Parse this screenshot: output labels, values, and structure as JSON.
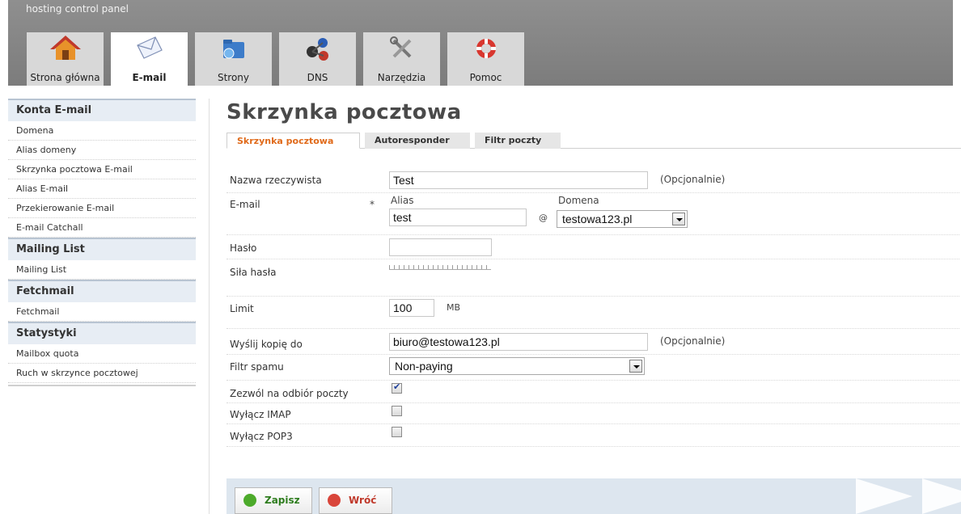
{
  "header": {
    "title": "hosting control panel",
    "tabs": [
      {
        "label": "Strona główna",
        "icon": "home-icon"
      },
      {
        "label": "E-mail",
        "icon": "envelope-icon",
        "active": true
      },
      {
        "label": "Strony",
        "icon": "folder-globe-icon"
      },
      {
        "label": "DNS",
        "icon": "network-icon"
      },
      {
        "label": "Narzędzia",
        "icon": "tools-icon"
      },
      {
        "label": "Pomoc",
        "icon": "lifebuoy-icon"
      }
    ]
  },
  "sidebar": {
    "sections": [
      {
        "title": "Konta E-mail",
        "items": [
          "Domena",
          "Alias domeny",
          "Skrzynka pocztowa E-mail",
          "Alias E-mail",
          "Przekierowanie E-mail",
          "E-mail Catchall"
        ]
      },
      {
        "title": "Mailing List",
        "items": [
          "Mailing List"
        ]
      },
      {
        "title": "Fetchmail",
        "items": [
          "Fetchmail"
        ]
      },
      {
        "title": "Statystyki",
        "items": [
          "Mailbox quota",
          "Ruch w skrzynce pocztowej"
        ]
      }
    ]
  },
  "main": {
    "title": "Skrzynka pocztowa",
    "tabs": [
      "Skrzynka pocztowa",
      "Autoresponder",
      "Filtr poczty"
    ],
    "form": {
      "real_name_label": "Nazwa rzeczywista",
      "real_name_value": "Test",
      "optional_hint": "(Opcjonalnie)",
      "email_label": "E-mail",
      "required_mark": "*",
      "alias_label": "Alias",
      "alias_value": "test",
      "at_sign": "@",
      "domain_label": "Domena",
      "domain_value": "testowa123.pl",
      "password_label": "Hasło",
      "password_value": "",
      "strength_label": "Siła hasła",
      "limit_label": "Limit",
      "limit_value": "100",
      "limit_unit": "MB",
      "copy_label": "Wyślij kopię do",
      "copy_value": "biuro@testowa123.pl",
      "spam_label": "Filtr spamu",
      "spam_value": "Non-paying",
      "receive_label": "Zezwól na odbiór poczty",
      "receive_checked": true,
      "imap_label": "Wyłącz IMAP",
      "imap_checked": false,
      "pop3_label": "Wyłącz POP3",
      "pop3_checked": false
    },
    "buttons": {
      "save": "Zapisz",
      "back": "Wróć"
    }
  },
  "colors": {
    "active_tab_text": "#e06a1a",
    "banner": "#848484",
    "sidebar_header": "#e7edf4",
    "action_bar": "#dde6ef"
  }
}
